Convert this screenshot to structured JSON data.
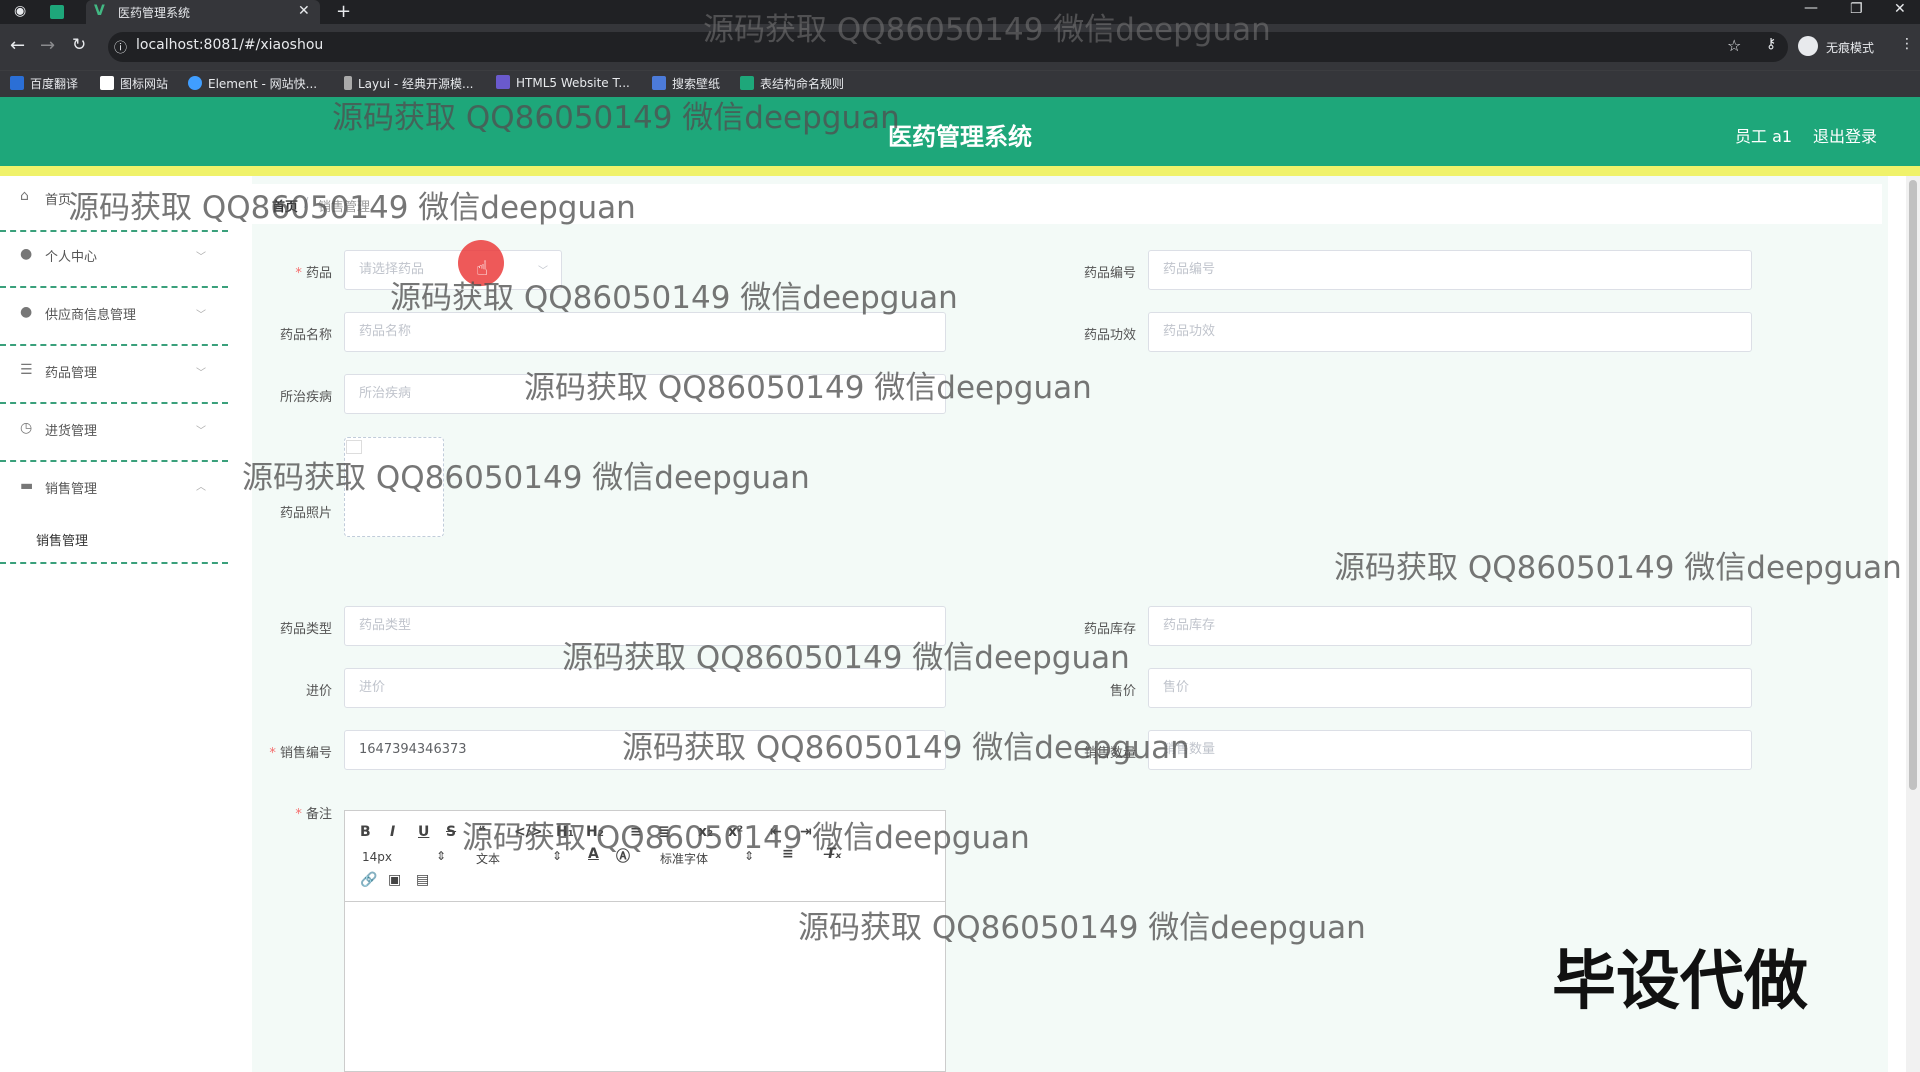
{
  "browser": {
    "tab_title": "医药管理系统",
    "url": "localhost:8081/#/xiaoshou",
    "profile_label": "无痕模式",
    "bookmarks": [
      "百度翻译",
      "图标网站",
      "Element - 网站快...",
      "Layui - 经典开源模...",
      "HTML5 Website T...",
      "搜索壁纸",
      "表结构命名规则"
    ]
  },
  "header": {
    "title": "医药管理系统",
    "user": "员工 a1",
    "logout": "退出登录"
  },
  "sidebar": {
    "items": [
      {
        "label": "首页",
        "icon": "home-icon"
      },
      {
        "label": "个人中心",
        "icon": "user-icon"
      },
      {
        "label": "供应商信息管理",
        "icon": "user-icon"
      },
      {
        "label": "药品管理",
        "icon": "list-icon"
      },
      {
        "label": "进货管理",
        "icon": "clock-icon"
      },
      {
        "label": "销售管理",
        "icon": "briefcase-icon"
      }
    ],
    "sub_item": "销售管理"
  },
  "breadcrumb": {
    "home": "首页",
    "sep": "/",
    "current": "销售管理"
  },
  "form": {
    "drug_select": {
      "label": "药品",
      "placeholder": "请选择药品"
    },
    "drug_code": {
      "label": "药品编号",
      "placeholder": "药品编号"
    },
    "drug_name": {
      "label": "药品名称",
      "placeholder": "药品名称"
    },
    "drug_effect": {
      "label": "药品功效",
      "placeholder": "药品功效"
    },
    "disease": {
      "label": "所治疾病",
      "placeholder": "所治疾病"
    },
    "photo": {
      "label": "药品照片"
    },
    "drug_type": {
      "label": "药品类型",
      "placeholder": "药品类型"
    },
    "stock": {
      "label": "药品库存",
      "placeholder": "药品库存"
    },
    "cost": {
      "label": "进价",
      "placeholder": "进价"
    },
    "price": {
      "label": "售价",
      "placeholder": "售价"
    },
    "sale_no": {
      "label": "销售编号",
      "value": "1647394346373"
    },
    "sale_qty": {
      "label": "销售数量",
      "placeholder": "销售数量"
    },
    "remark": {
      "label": "备注"
    }
  },
  "editor": {
    "font_size": "14px",
    "format": "文本",
    "font_family": "标准字体"
  },
  "watermarks": [
    "源码获取 QQ86050149 微信deepguan",
    "源码获取 QQ86050149 微信deepguan",
    "源码获取 QQ86050149 微信deepguan",
    "源码获取 QQ86050149 微信deepguan",
    "源码获取 QQ86050149 微信deepguan",
    "源码获取 QQ86050149 微信deepguan",
    "源码获取 QQ86050149 微信deepguan",
    "源码获取 QQ86050149 微信deepguan",
    "源码获取 QQ86050149 微信deepguan",
    "源码获取 QQ86050149 微信deepguan",
    "源码获取 QQ86050149 微信deepguan"
  ],
  "stamp": "毕设代做"
}
